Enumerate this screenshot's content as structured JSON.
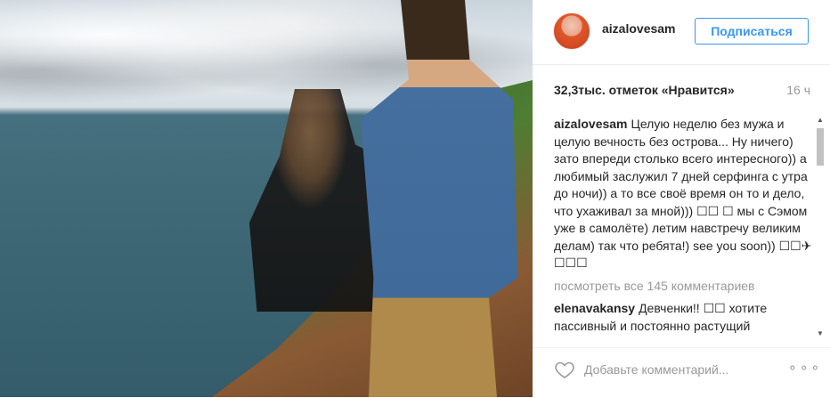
{
  "post": {
    "username": "aizalovesam",
    "follow_label": "Подписаться",
    "likes": "32,3тыс. отметок «Нравится»",
    "time": "16 ч",
    "comments": [
      {
        "user": "aizalovesam",
        "text": "Целую неделю без мужа и целую вечность без острова... Ну ничего) зато впереди столько всего интересного)) а любимый заслужил 7 дней серфинга с утра до ночи)) а то все своё время он то и дело, что ухаживал за мной))) ☐☐ ☐ мы с Сэмом уже в самолёте) летим навстречу великим делам) так что ребята!) see you soon)) ☐☐✈☐☐☐"
      }
    ],
    "view_all": "посмотреть все 145 комментариев",
    "comments_more": [
      {
        "user": "elenavakansy",
        "text": "Девченки!! ☐☐ хотите пассивный и постоянно растущий"
      }
    ],
    "add_comment_placeholder": "Добавьте комментарий...",
    "more_label": "⚬⚬⚬"
  },
  "icons": {
    "heart": "heart-icon",
    "more": "more-options-icon"
  },
  "colors": {
    "accent": "#3897f0",
    "muted": "#999999",
    "text": "#262626"
  }
}
